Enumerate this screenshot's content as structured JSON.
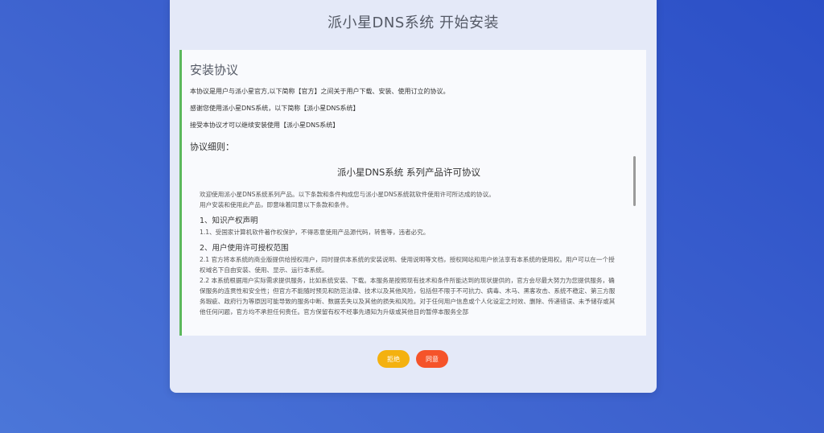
{
  "page_title": "派小星DNS系统 开始安装",
  "agreement": {
    "title": "安装协议",
    "intro": [
      "本协议是用户与派小星官方,以下简称【官方】之间关于用户下载、安装、使用订立的协议。",
      "感谢您使用派小星DNS系统，以下简称【派小星DNS系统】",
      "接受本协议才可以继续安装使用【派小星DNS系统】"
    ],
    "detail_label": "协议细则：",
    "license": {
      "title": "派小星DNS系统 系列产品许可协议",
      "preamble": [
        "欢迎使用派小星DNS系统系列产品。以下条款和条件构成您与派小星DNS系统就软件使用许可所达成的协议。",
        "用户安装和使用此产品，即意味着同意以下条款和条件。"
      ],
      "sections": [
        {
          "heading": "1、知识产权声明",
          "paragraphs": [
            "1.1、受国家计算机软件著作权保护，不得恶意使用产品源代码，转售等，违者必究。"
          ]
        },
        {
          "heading": "2、用户使用许可授权范围",
          "paragraphs": [
            "2.1 官方将本系统的商业版提供给授权用户，同时提供本系统的安装说明、使用说明等文档，授权网站和用户依法享有本系统的使用权。用户可以在一个授权域名下自由安装、使用、显示、运行本系统。",
            "2.2 本系统根据用户实际需求提供服务，比如系统安装、下载。本服务是按照现有技术和条件所能达到的现状提供的，官方会尽最大努力为您提供服务，确保服务的连贯性和安全性；但官方不能随时预见和防范法律、技术以及其他风险，包括但不限于不可抗力、病毒、木马、黑客攻击、系统不稳定、第三方服务瑕疵、政府行为等原因可能导致的服务中断、数据丢失以及其他的损失和风险。对于任何用户信息或个人化设定之时效、删除、传递错误、未予储存或其他任何问题，官方均不承担任何责任。官方保留有权不经事先通知为升级或其他目的暂停本服务全部"
          ]
        }
      ]
    }
  },
  "buttons": {
    "reject": "拒绝",
    "agree": "同意"
  },
  "colors": {
    "accent_border": "#5cb85c",
    "reject_button": "#f4b10f",
    "agree_button": "#f5532a"
  }
}
